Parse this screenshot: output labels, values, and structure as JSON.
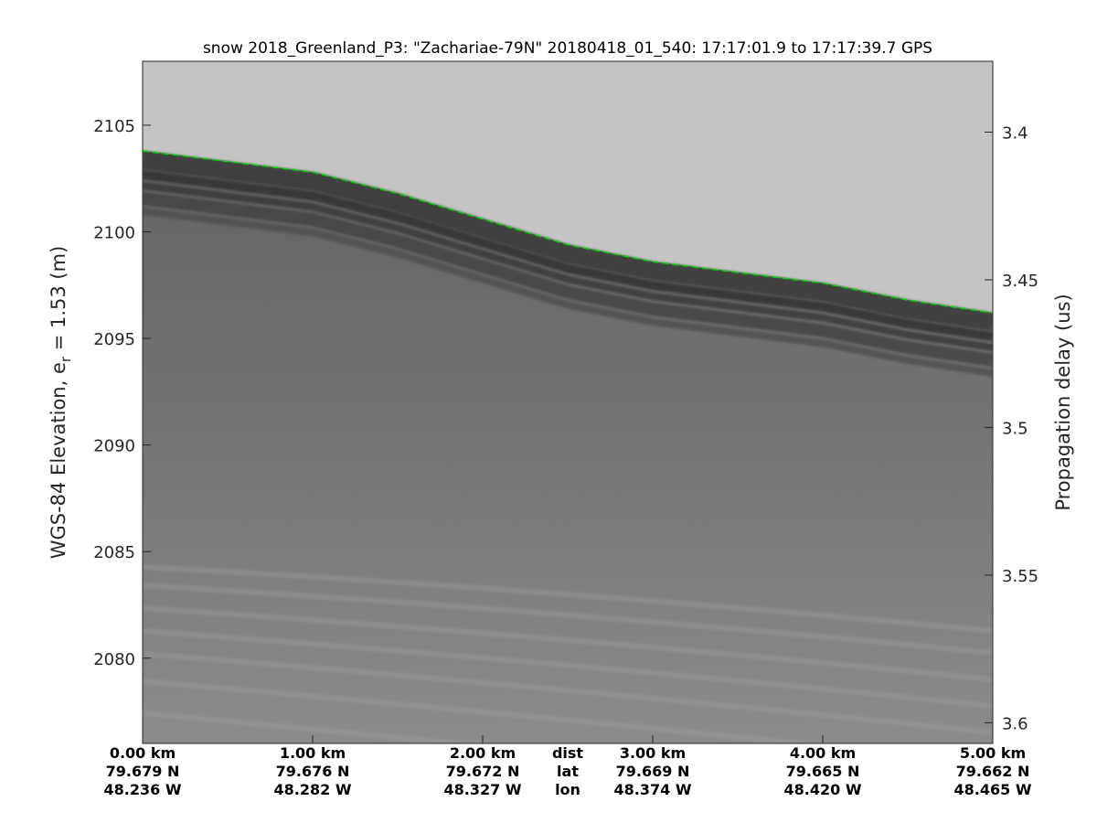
{
  "chart_data": {
    "type": "radar-echogram",
    "title": "snow 2018_Greenland_P3: \"Zachariae-79N\"  20180418_01_540: 17:17:01.9 to 17:17:39.7 GPS",
    "ylabel_left": "WGS-84 Elevation, e",
    "ylabel_left_sub": "r",
    "ylabel_left_suffix": " = 1.53 (m)",
    "ylabel_right": "Propagation delay (us)",
    "ylim_left": [
      2076,
      2108
    ],
    "yticks_left": [
      2105,
      2100,
      2095,
      2090,
      2085,
      2080
    ],
    "ylim_right": [
      3.376,
      3.607
    ],
    "yticks_right": [
      3.4,
      3.45,
      3.5,
      3.55,
      3.6
    ],
    "ytick_labels_right": [
      "3.4",
      "3.45",
      "3.5",
      "3.55",
      "3.6"
    ],
    "xlim_km": [
      0,
      5
    ],
    "row_labels": {
      "dist": "dist",
      "lat": "lat",
      "lon": "lon"
    },
    "x_ticks": [
      {
        "km": 0,
        "dist": "0.00 km",
        "lat": "79.679 N",
        "lon": "48.236 W"
      },
      {
        "km": 1,
        "dist": "1.00 km",
        "lat": "79.676 N",
        "lon": "48.282 W"
      },
      {
        "km": 2,
        "dist": "2.00 km",
        "lat": "79.672 N",
        "lon": "48.327 W"
      },
      {
        "km": 3,
        "dist": "3.00 km",
        "lat": "79.669 N",
        "lon": "48.374 W"
      },
      {
        "km": 4,
        "dist": "4.00 km",
        "lat": "79.665 N",
        "lon": "48.420 W"
      },
      {
        "km": 5,
        "dist": "5.00 km",
        "lat": "79.662 N",
        "lon": "48.465 W"
      }
    ],
    "surface_pick": {
      "color": "#00dd00",
      "style": "dashed",
      "km": [
        0,
        0.5,
        1.0,
        1.5,
        2.0,
        2.5,
        3.0,
        3.5,
        4.0,
        4.5,
        5.0
      ],
      "elevation_m": [
        2103.8,
        2103.3,
        2102.8,
        2101.8,
        2100.6,
        2099.4,
        2098.6,
        2098.1,
        2097.6,
        2096.8,
        2096.2
      ]
    },
    "colormap": "grayscale"
  }
}
